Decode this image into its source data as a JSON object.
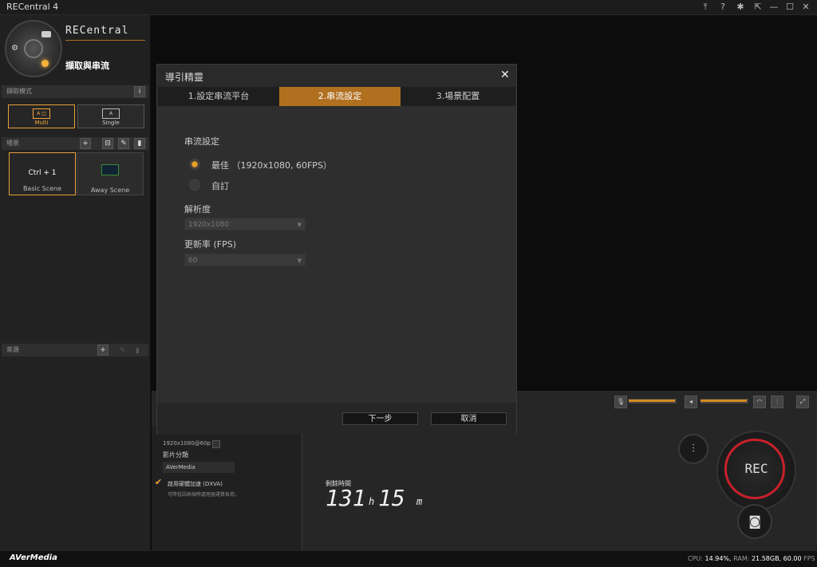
{
  "window": {
    "title": "RECentral 4",
    "controls": [
      "⤒",
      "?",
      "✱",
      "⇱",
      "—",
      "☐",
      "✕"
    ]
  },
  "sidebar": {
    "brand": "RECentral",
    "mode_label": "擷取與串流",
    "capture_mode_header": "擷取模式",
    "capture_modes": [
      {
        "label": "Multi",
        "icon": "A ◫"
      },
      {
        "label": "Single",
        "icon": "A"
      }
    ],
    "scene_header": "場景",
    "scenes": [
      {
        "hotkey": "Ctrl + 1",
        "name": "Basic Scene"
      },
      {
        "hotkey": "",
        "name": "Away Scene"
      }
    ],
    "source_header": "來源",
    "info_icon": "i"
  },
  "dialog": {
    "title": "導引精靈",
    "close": "✕",
    "tabs": [
      "1.設定串流平台",
      "2.串流設定",
      "3.場景配置"
    ],
    "section_title": "串流設定",
    "options": [
      {
        "label": "最佳 （1920x1080, 60FPS）",
        "selected": true
      },
      {
        "label": "自訂",
        "selected": false
      }
    ],
    "resolution_label": "解析度",
    "resolution_value": "1920x1080",
    "fps_label": "更新率 (FPS)",
    "fps_value": "60",
    "next_button": "下一步",
    "cancel_button": "取消"
  },
  "bottom": {
    "res_info": "1920x1080@60p",
    "video_category_label": "影片分類",
    "video_category_value": "AVerMedia",
    "dxva_label": "啟用硬體加速 (DXVA)",
    "dxva_sub": "可降低因高幀時處理器運算負荷。",
    "remaining_label": "剩餘時間",
    "remaining_hours": "131",
    "h_unit": "h",
    "remaining_mins": "15",
    "m_unit": "m",
    "rec_label": "REC"
  },
  "status": {
    "brand": "AVerMedia",
    "cpu_label": "CPU:",
    "cpu": "14.94%,",
    "ram_label": "RAM:",
    "ram": "21.58GB,",
    "fps": "60.00",
    "fps_label": "FPS"
  },
  "colors": {
    "accent": "#d28a22",
    "rec_ring": "#c8202a"
  }
}
